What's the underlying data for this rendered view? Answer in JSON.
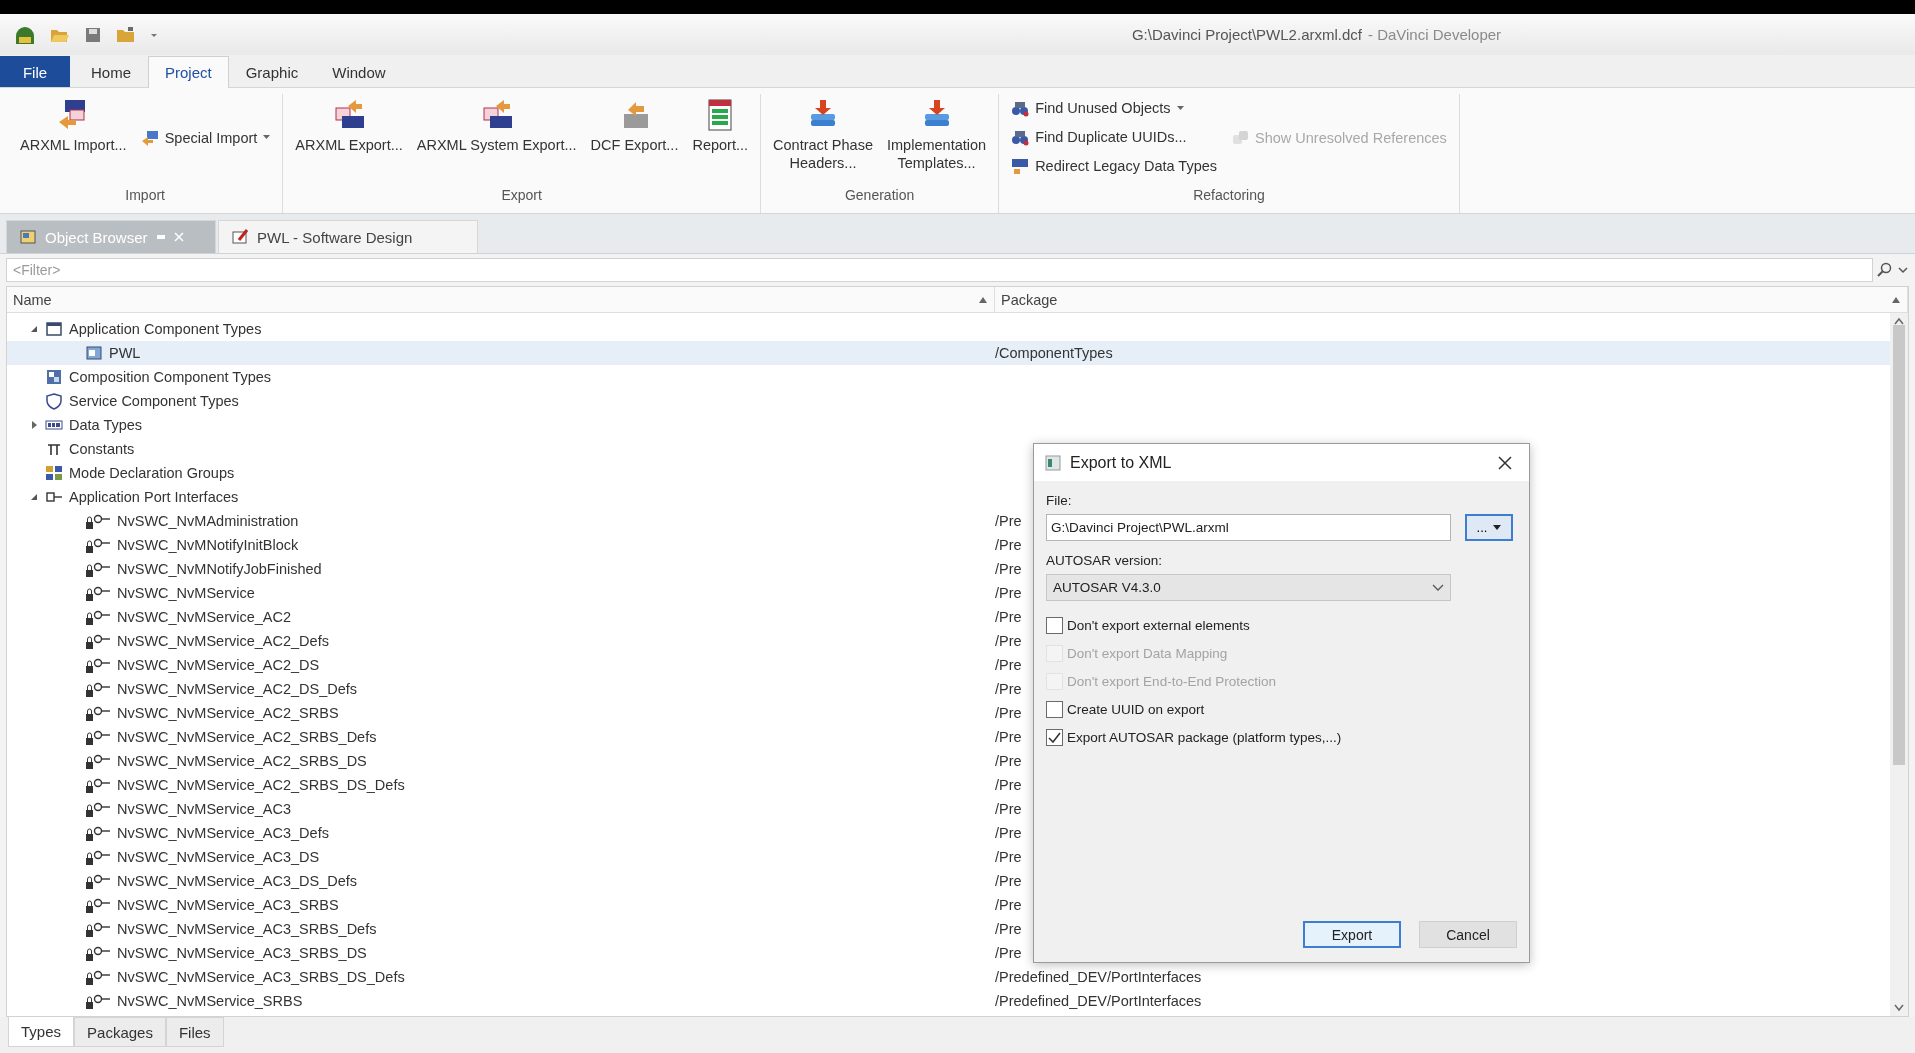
{
  "window": {
    "title": "G:\\Davinci Project\\PWL2.arxml.dcf",
    "app_name": "- DaVinci Developer"
  },
  "menu_tabs": [
    {
      "label": "File",
      "kind": "file",
      "selected": false
    },
    {
      "label": "Home",
      "kind": "tab",
      "selected": false
    },
    {
      "label": "Project",
      "kind": "tab",
      "selected": true
    },
    {
      "label": "Graphic",
      "kind": "tab",
      "selected": false
    },
    {
      "label": "Window",
      "kind": "tab",
      "selected": false
    }
  ],
  "ribbon": [
    {
      "name": "Import",
      "columns": [
        [
          {
            "label": "ARXML Import...",
            "kind": "large"
          }
        ],
        [
          {
            "label": "Special Import",
            "kind": "small",
            "dropdown": true
          }
        ]
      ]
    },
    {
      "name": "Export",
      "columns": [
        [
          {
            "label": "ARXML Export...",
            "kind": "large"
          }
        ],
        [
          {
            "label": "ARXML System Export...",
            "kind": "large"
          }
        ],
        [
          {
            "label": "DCF Export...",
            "kind": "large"
          }
        ],
        [
          {
            "label": "Report...",
            "kind": "large"
          }
        ]
      ]
    },
    {
      "name": "Generation",
      "columns": [
        [
          {
            "label": "Contract Phase\nHeaders...",
            "kind": "large"
          }
        ],
        [
          {
            "label": "Implementation\nTemplates...",
            "kind": "large"
          }
        ]
      ]
    },
    {
      "name": "Refactoring",
      "columns": [
        [
          {
            "label": "Find Unused Objects",
            "kind": "small",
            "dropdown": true
          },
          {
            "label": "Find Duplicate UUIDs...",
            "kind": "small",
            "dropdown": false
          },
          {
            "label": "Redirect Legacy Data Types",
            "kind": "small",
            "dropdown": false
          }
        ],
        [
          {
            "label": "Show Unresolved References",
            "kind": "small",
            "disabled": true
          }
        ]
      ]
    }
  ],
  "doc_tabs": [
    {
      "label": "Object Browser",
      "selected": true
    },
    {
      "label": "PWL - Software Design",
      "selected": false
    }
  ],
  "filter": {
    "placeholder": "<Filter>"
  },
  "table": {
    "columns": [
      "Name",
      "Package"
    ],
    "rows": [
      {
        "name": "Application Component Types",
        "kind": "component",
        "expanded": true,
        "selected": false,
        "children": [
          {
            "name": "PWL",
            "kind": "swc",
            "package": "/ComponentTypes",
            "selected": true
          }
        ]
      },
      {
        "name": "Composition Component Types",
        "kind": "composition",
        "selected": false
      },
      {
        "name": "Service Component Types",
        "kind": "service",
        "selected": false
      },
      {
        "name": "Data Types",
        "kind": "datatype",
        "expanded": false,
        "selected": false
      },
      {
        "name": "Constants",
        "kind": "constant",
        "selected": false
      },
      {
        "name": "Mode Declaration Groups",
        "kind": "mode",
        "selected": false
      },
      {
        "name": "Application Port Interfaces",
        "kind": "interface",
        "expanded": true,
        "selected": false,
        "children": [
          {
            "name": "NvSWC_NvMAdministration",
            "kind": "port",
            "package": "/Pre",
            "selected": false
          },
          {
            "name": "NvSWC_NvMNotifyInitBlock",
            "kind": "port",
            "package": "/Pre",
            "selected": false
          },
          {
            "name": "NvSWC_NvMNotifyJobFinished",
            "kind": "port",
            "package": "/Pre",
            "selected": false
          },
          {
            "name": "NvSWC_NvMService",
            "kind": "port",
            "package": "/Pre",
            "selected": false
          },
          {
            "name": "NvSWC_NvMService_AC2",
            "kind": "port",
            "package": "/Pre",
            "selected": false
          },
          {
            "name": "NvSWC_NvMService_AC2_Defs",
            "kind": "port",
            "package": "/Pre",
            "selected": false
          },
          {
            "name": "NvSWC_NvMService_AC2_DS",
            "kind": "port",
            "package": "/Pre",
            "selected": false
          },
          {
            "name": "NvSWC_NvMService_AC2_DS_Defs",
            "kind": "port",
            "package": "/Pre",
            "selected": false
          },
          {
            "name": "NvSWC_NvMService_AC2_SRBS",
            "kind": "port",
            "package": "/Pre",
            "selected": false
          },
          {
            "name": "NvSWC_NvMService_AC2_SRBS_Defs",
            "kind": "port",
            "package": "/Pre",
            "selected": false
          },
          {
            "name": "NvSWC_NvMService_AC2_SRBS_DS",
            "kind": "port",
            "package": "/Pre",
            "selected": false
          },
          {
            "name": "NvSWC_NvMService_AC2_SRBS_DS_Defs",
            "kind": "port",
            "package": "/Pre",
            "selected": false
          },
          {
            "name": "NvSWC_NvMService_AC3",
            "kind": "port",
            "package": "/Pre",
            "selected": false
          },
          {
            "name": "NvSWC_NvMService_AC3_Defs",
            "kind": "port",
            "package": "/Pre",
            "selected": false
          },
          {
            "name": "NvSWC_NvMService_AC3_DS",
            "kind": "port",
            "package": "/Pre",
            "selected": false
          },
          {
            "name": "NvSWC_NvMService_AC3_DS_Defs",
            "kind": "port",
            "package": "/Pre",
            "selected": false
          },
          {
            "name": "NvSWC_NvMService_AC3_SRBS",
            "kind": "port",
            "package": "/Pre",
            "selected": false
          },
          {
            "name": "NvSWC_NvMService_AC3_SRBS_Defs",
            "kind": "port",
            "package": "/Pre",
            "selected": false
          },
          {
            "name": "NvSWC_NvMService_AC3_SRBS_DS",
            "kind": "port",
            "package": "/Pre",
            "selected": false
          },
          {
            "name": "NvSWC_NvMService_AC3_SRBS_DS_Defs",
            "kind": "port",
            "package": "/Predefined_DEV/PortInterfaces",
            "selected": false
          },
          {
            "name": "NvSWC_NvMService_SRBS",
            "kind": "port",
            "package": "/Predefined_DEV/PortInterfaces",
            "selected": false
          }
        ]
      }
    ]
  },
  "dialog": {
    "title": "Export to XML",
    "file_label": "File:",
    "file_value": "G:\\Davinci Project\\PWL.arxml",
    "browse_label": "...",
    "version_label": "AUTOSAR version:",
    "version_value": "AUTOSAR V4.3.0",
    "options": [
      {
        "label": "Don't export external elements",
        "checked": false,
        "disabled": false
      },
      {
        "label": "Don't export Data Mapping",
        "checked": false,
        "disabled": true
      },
      {
        "label": "Don't export End-to-End Protection",
        "checked": false,
        "disabled": true
      },
      {
        "label": "Create UUID on export",
        "checked": false,
        "disabled": false
      },
      {
        "label": "Export AUTOSAR package (platform types,...)",
        "checked": true,
        "disabled": false
      }
    ],
    "buttons": [
      {
        "label": "Export",
        "default": true
      },
      {
        "label": "Cancel",
        "default": false
      }
    ]
  },
  "bottom_tabs": [
    {
      "label": "Types",
      "selected": true
    },
    {
      "label": "Packages",
      "selected": false
    },
    {
      "label": "Files",
      "selected": false
    }
  ]
}
